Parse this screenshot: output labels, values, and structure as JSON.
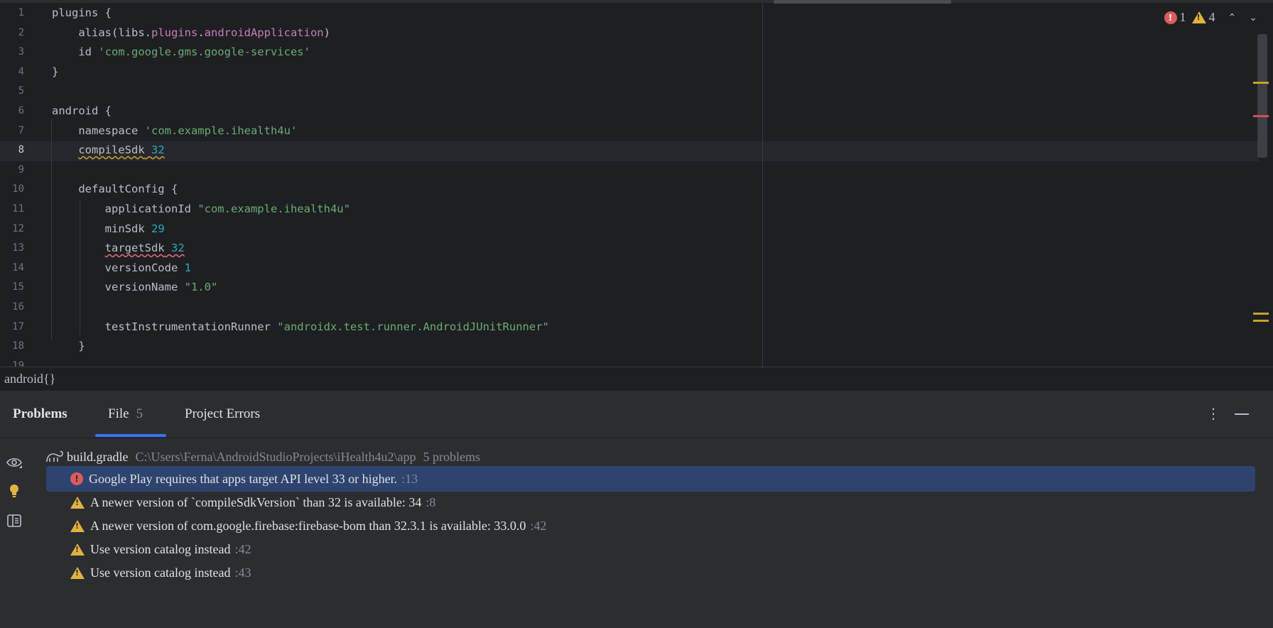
{
  "editor": {
    "lines": [
      {
        "num": "1",
        "parts": [
          {
            "t": "plugins {",
            "c": "plain"
          }
        ]
      },
      {
        "num": "2",
        "parts": [
          {
            "t": "    alias(libs.",
            "c": "plain"
          },
          {
            "t": "plugins",
            "c": "prop"
          },
          {
            "t": ".",
            "c": "plain"
          },
          {
            "t": "androidApplication",
            "c": "prop"
          },
          {
            "t": ")",
            "c": "plain"
          }
        ]
      },
      {
        "num": "3",
        "parts": [
          {
            "t": "    id ",
            "c": "plain"
          },
          {
            "t": "'com.google.gms.google-services'",
            "c": "str"
          }
        ]
      },
      {
        "num": "4",
        "parts": [
          {
            "t": "}",
            "c": "plain"
          }
        ]
      },
      {
        "num": "5",
        "parts": []
      },
      {
        "num": "6",
        "parts": [
          {
            "t": "android {",
            "c": "plain"
          }
        ]
      },
      {
        "num": "7",
        "parts": [
          {
            "t": "    namespace ",
            "c": "plain"
          },
          {
            "t": "'com.example.ihealth4u'",
            "c": "str"
          }
        ]
      },
      {
        "num": "8",
        "current": true,
        "parts": [
          {
            "t": "    ",
            "c": "plain"
          },
          {
            "t": "compileSdk",
            "c": "warn"
          },
          {
            "t": " ",
            "c": "warn"
          },
          {
            "t": "32",
            "c": "num-warn"
          }
        ]
      },
      {
        "num": "9",
        "parts": []
      },
      {
        "num": "10",
        "parts": [
          {
            "t": "    defaultConfig {",
            "c": "plain"
          }
        ]
      },
      {
        "num": "11",
        "parts": [
          {
            "t": "        applicationId ",
            "c": "plain"
          },
          {
            "t": "\"com.example.ihealth4u\"",
            "c": "str"
          }
        ]
      },
      {
        "num": "12",
        "parts": [
          {
            "t": "        minSdk ",
            "c": "plain"
          },
          {
            "t": "29",
            "c": "num"
          }
        ]
      },
      {
        "num": "13",
        "parts": [
          {
            "t": "        ",
            "c": "plain"
          },
          {
            "t": "targetSdk",
            "c": "err"
          },
          {
            "t": " ",
            "c": "err"
          },
          {
            "t": "32",
            "c": "num-err"
          }
        ]
      },
      {
        "num": "14",
        "parts": [
          {
            "t": "        versionCode ",
            "c": "plain"
          },
          {
            "t": "1",
            "c": "num"
          }
        ]
      },
      {
        "num": "15",
        "parts": [
          {
            "t": "        versionName ",
            "c": "plain"
          },
          {
            "t": "\"1.0\"",
            "c": "str"
          }
        ]
      },
      {
        "num": "16",
        "parts": []
      },
      {
        "num": "17",
        "parts": [
          {
            "t": "        testInstrumentationRunner ",
            "c": "plain"
          },
          {
            "t": "\"androidx.test.runner.AndroidJUnitRunner\"",
            "c": "str"
          }
        ]
      },
      {
        "num": "18",
        "parts": [
          {
            "t": "    }",
            "c": "plain"
          }
        ]
      },
      {
        "num": "19",
        "parts": []
      }
    ],
    "inspection": {
      "errors": "1",
      "warnings": "4"
    },
    "colors": {
      "string": "#6aab73",
      "number": "#2aacb8",
      "property": "#c77dbb",
      "error": "#db5c5c",
      "warning": "#e0b340"
    }
  },
  "breadcrumb": "android{}",
  "problems": {
    "title": "Problems",
    "tabs": {
      "file": "File",
      "file_count": "5",
      "project_errors": "Project Errors"
    },
    "file": {
      "name": "build.gradle",
      "path": "C:\\Users\\Ferna\\AndroidStudioProjects\\iHealth4u2\\app",
      "count": "5 problems"
    },
    "items": [
      {
        "severity": "error",
        "text": "Google Play requires that apps target API level 33 or higher.",
        "loc": ":13",
        "selected": true
      },
      {
        "severity": "warning",
        "text": "A newer version of `compileSdkVersion` than 32 is available: 34",
        "loc": ":8"
      },
      {
        "severity": "warning",
        "text": "A newer version of com.google.firebase:firebase-bom than 32.3.1 is available: 33.0.0",
        "loc": ":42"
      },
      {
        "severity": "warning",
        "text": "Use version catalog instead",
        "loc": ":42"
      },
      {
        "severity": "warning",
        "text": "Use version catalog instead",
        "loc": ":43"
      }
    ],
    "selection_color": "#2e436e",
    "tab_accent": "#3574f0"
  }
}
